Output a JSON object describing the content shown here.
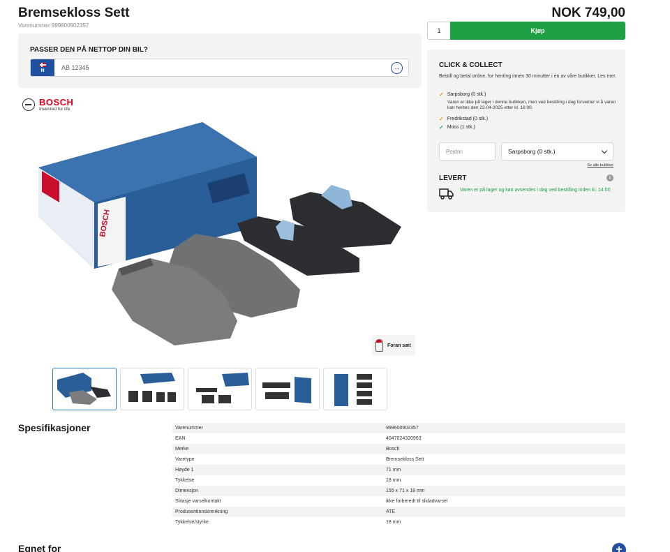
{
  "product": {
    "title": "Bremsekloss Sett",
    "sku_label": "Varenummer 999600902357",
    "price": "NOK 749,00"
  },
  "buy": {
    "quantity": "1",
    "button_label": "Kjøp"
  },
  "car_check": {
    "title": "PASSER DEN PÅ NETTOP DIN BIL?",
    "country_code": "N",
    "plate_placeholder": "AB 12345"
  },
  "brand": {
    "name": "BOSCH",
    "tagline": "Invented for life"
  },
  "image": {
    "front_badge": "Foran sæt"
  },
  "thumbnails": [
    {
      "name": "thumb-1"
    },
    {
      "name": "thumb-2"
    },
    {
      "name": "thumb-3"
    },
    {
      "name": "thumb-4"
    },
    {
      "name": "thumb-5"
    }
  ],
  "click_collect": {
    "title": "CLICK & COLLECT",
    "description": "Bestill og betal online, for henting innen 30 minutter i en av våre butikker. Les mer.",
    "stores": [
      {
        "label": "Sarpsborg (0 stk.)",
        "status": "warn"
      },
      {
        "label": "Fredrikstad (0 stk.)",
        "status": "warn"
      },
      {
        "label": "Moss (1 stk.)",
        "status": "ok"
      }
    ],
    "store_note": "Varen er ikke på lager i denne butikken, men ved bestilling i dag forventer vi å varen kan hentes den 22-04-2025 etter kl. 16:00.",
    "postnr_placeholder": "Postnr.",
    "selected_store": "Sarpsborg (0 stk.)",
    "see_all": "Se alle butikker"
  },
  "delivery": {
    "title": "LEVERT",
    "text": "Varen er på lager og kan avsendes i dag ved bestilling inden kl. 14:00"
  },
  "specs": {
    "title": "Spesifikasjoner",
    "rows": [
      [
        "Varenummer",
        "999600902357"
      ],
      [
        "EAN",
        "4047024320963"
      ],
      [
        "Merke",
        "Bosch"
      ],
      [
        "Varetype",
        "Bremsekloss Sett"
      ],
      [
        "Høyde 1",
        "71 mm"
      ],
      [
        "Tykkelse",
        "18 mm"
      ],
      [
        "Dimensjon",
        "155 x 71 x 18 mm"
      ],
      [
        "Slitasje varselkontakt",
        "ikke forberedt til slidadvarsel"
      ],
      [
        "Produsentinnskrenkning",
        "ATE"
      ],
      [
        "Tykkelse/styrke",
        "18 mm"
      ]
    ]
  },
  "fits": {
    "title": "Egnet for"
  },
  "colors": {
    "buy_green": "#1ea045",
    "brand_red": "#e2001a",
    "accent_blue": "#1f4fa0",
    "panel_bg": "#f3f3f3"
  }
}
